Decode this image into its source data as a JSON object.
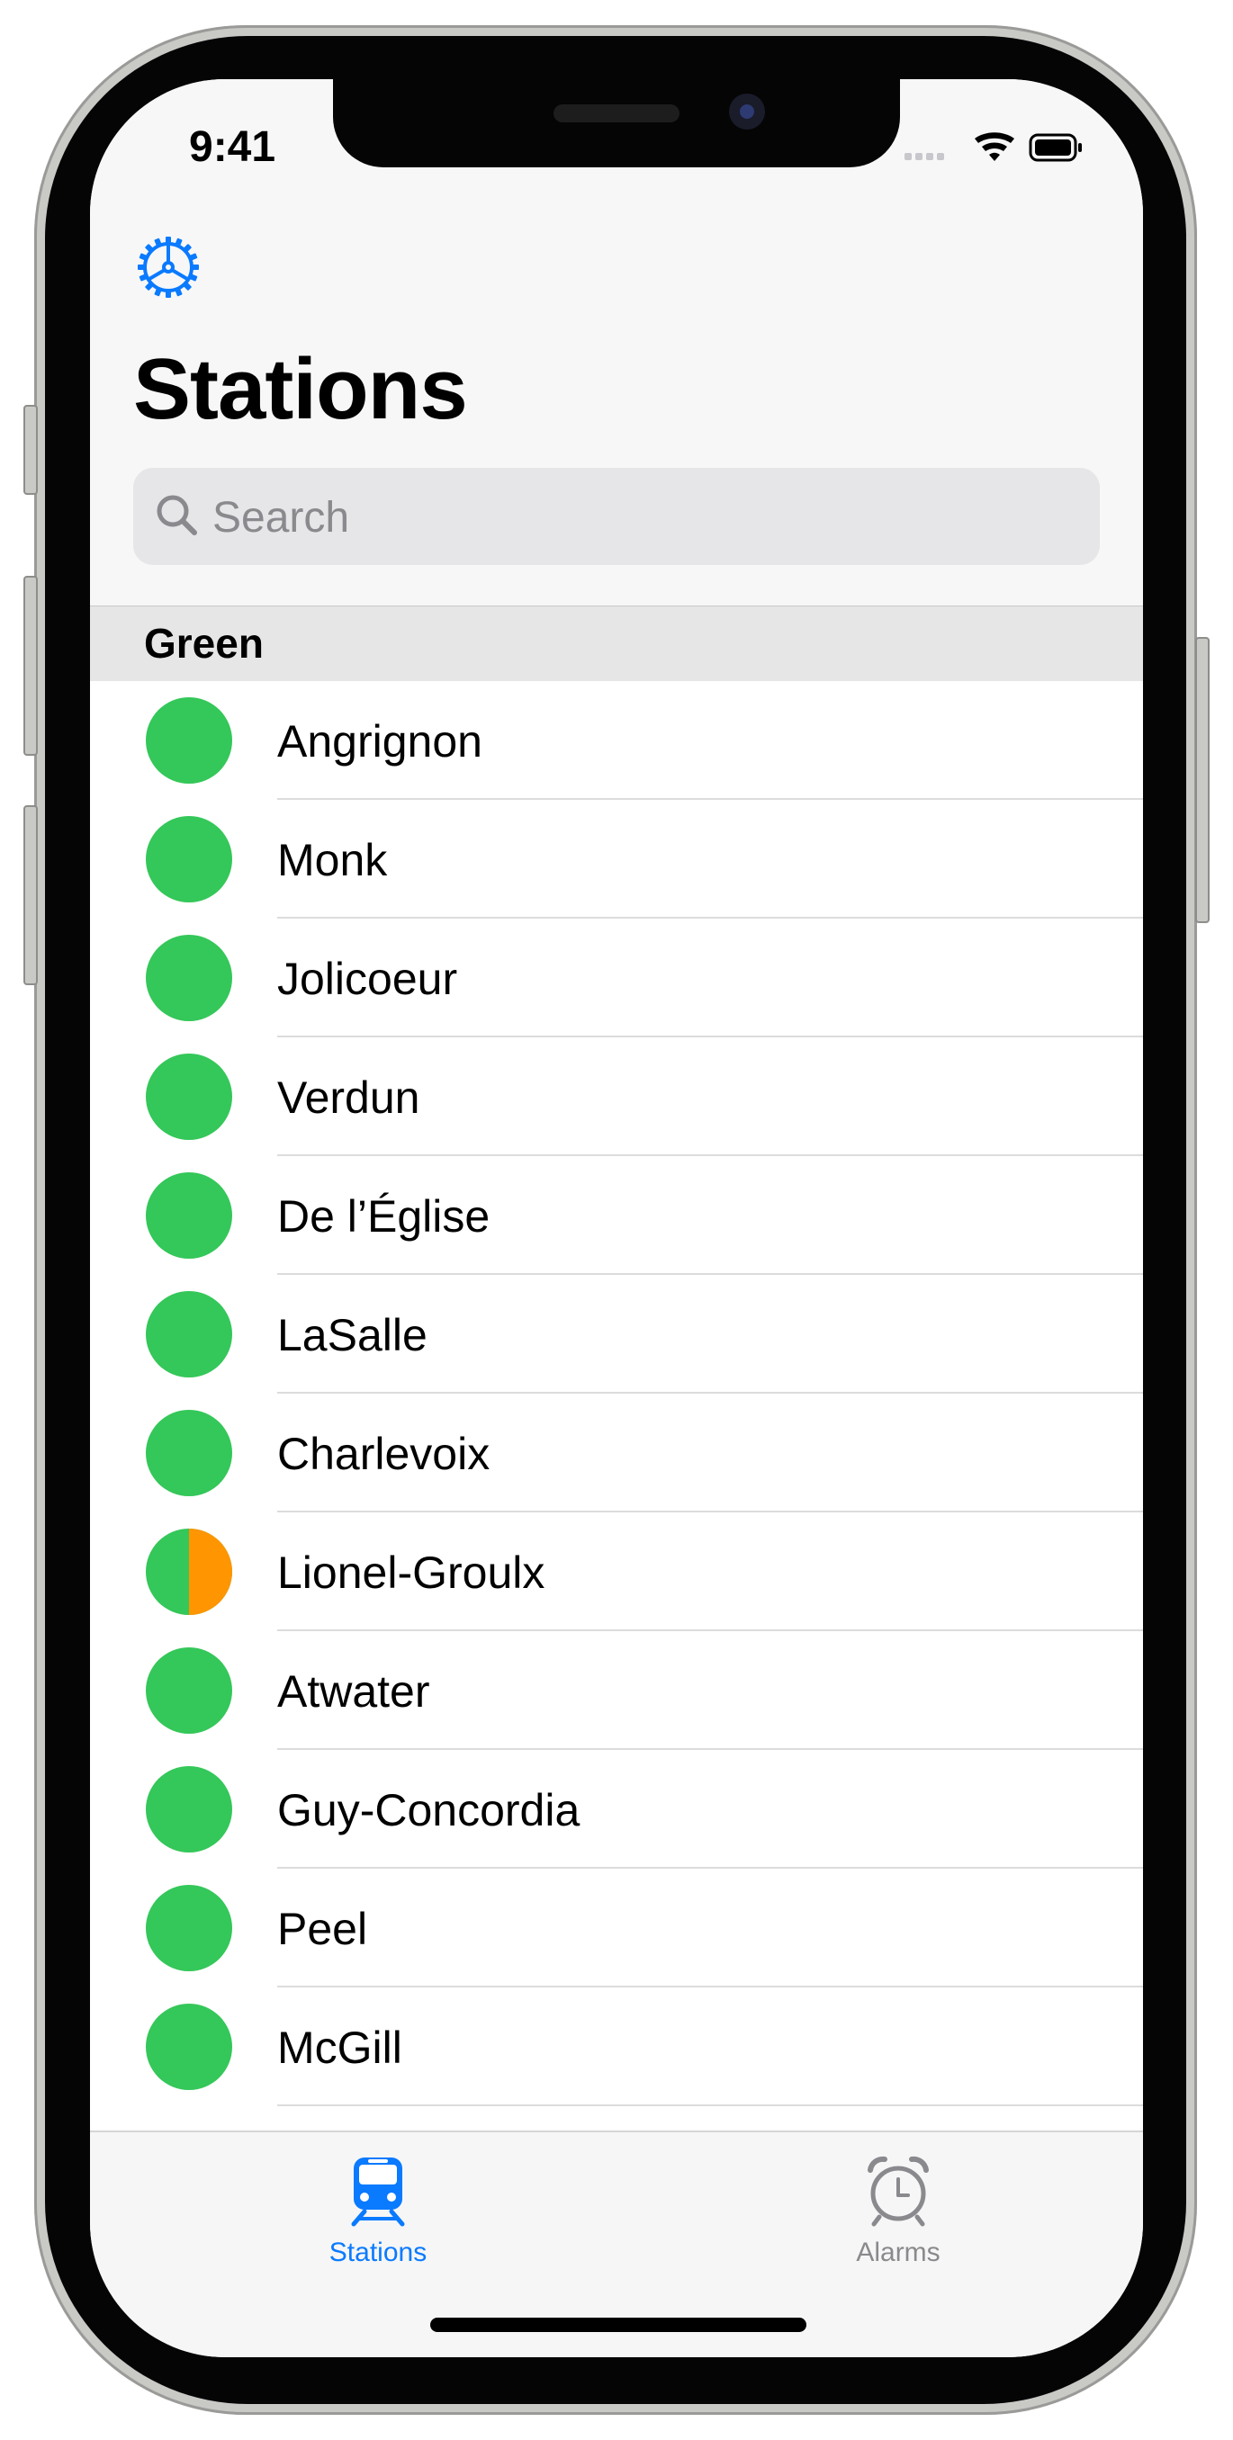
{
  "status_bar": {
    "time": "9:41"
  },
  "nav": {
    "settings_icon": "gear-icon",
    "title": "Stations"
  },
  "search": {
    "placeholder": "Search"
  },
  "section": {
    "label": "Green"
  },
  "colors": {
    "accent": "#0a7aff",
    "green_line": "#34c759",
    "orange_line": "#ff9500",
    "inactive_tab": "#8a8a8e"
  },
  "stations": [
    {
      "name": "Angrignon",
      "lines": [
        "green"
      ]
    },
    {
      "name": "Monk",
      "lines": [
        "green"
      ]
    },
    {
      "name": "Jolicoeur",
      "lines": [
        "green"
      ]
    },
    {
      "name": "Verdun",
      "lines": [
        "green"
      ]
    },
    {
      "name": "De l’Église",
      "lines": [
        "green"
      ]
    },
    {
      "name": "LaSalle",
      "lines": [
        "green"
      ]
    },
    {
      "name": "Charlevoix",
      "lines": [
        "green"
      ]
    },
    {
      "name": "Lionel-Groulx",
      "lines": [
        "green",
        "orange"
      ]
    },
    {
      "name": "Atwater",
      "lines": [
        "green"
      ]
    },
    {
      "name": "Guy-Concordia",
      "lines": [
        "green"
      ]
    },
    {
      "name": "Peel",
      "lines": [
        "green"
      ]
    },
    {
      "name": "McGill",
      "lines": [
        "green"
      ]
    }
  ],
  "tabs": [
    {
      "label": "Stations",
      "icon": "train-icon",
      "selected": true
    },
    {
      "label": "Alarms",
      "icon": "alarm-clock-icon",
      "selected": false
    }
  ]
}
